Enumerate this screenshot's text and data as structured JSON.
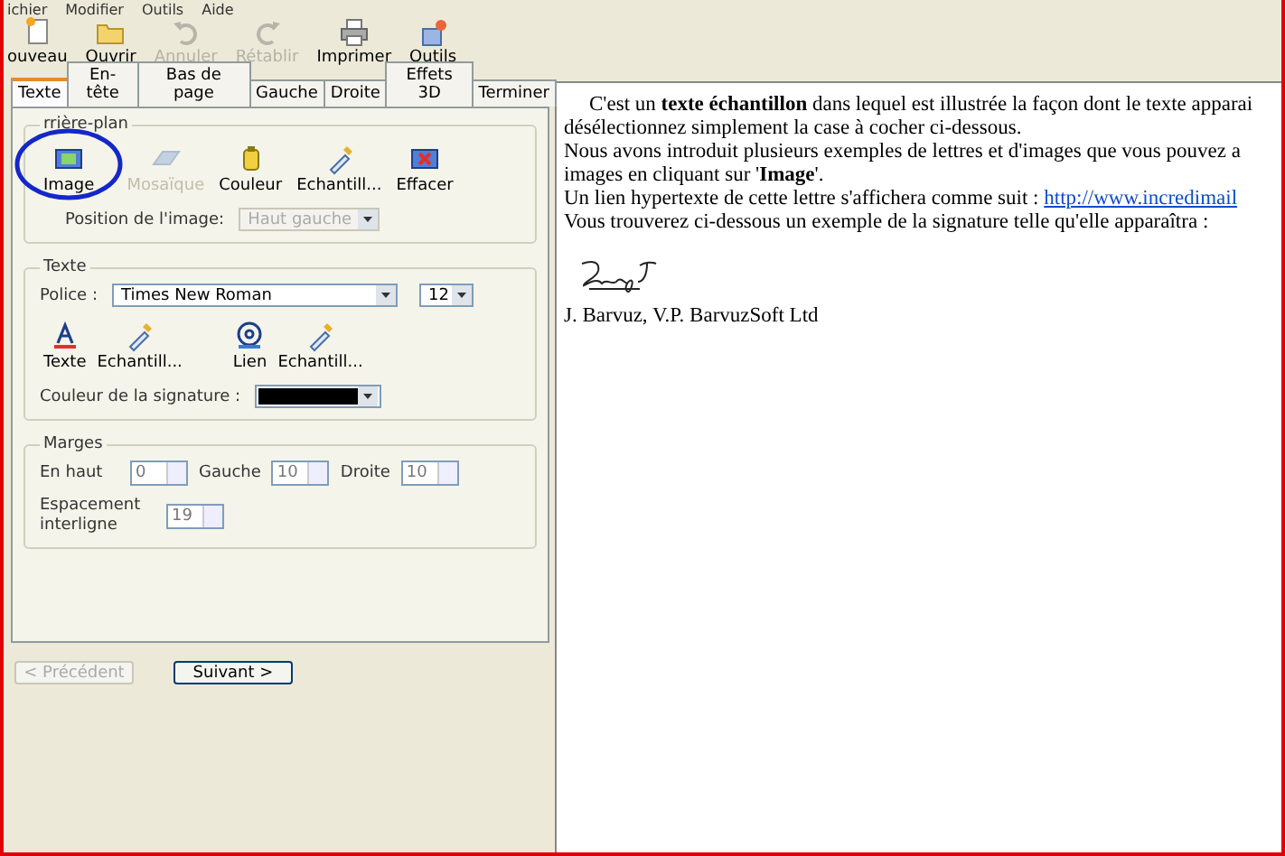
{
  "menu": [
    "ichier",
    "Modifier",
    "Outils",
    "Aide"
  ],
  "toolbar": [
    {
      "label": "ouveau",
      "disabled": false
    },
    {
      "label": "Ouvrir",
      "disabled": false
    },
    {
      "label": "Annuler",
      "disabled": true
    },
    {
      "label": "Rétablir",
      "disabled": true
    },
    {
      "label": "Imprimer",
      "disabled": false
    },
    {
      "label": "Outils",
      "disabled": false
    }
  ],
  "tabs": [
    {
      "label": "Texte",
      "selected": true
    },
    {
      "label": "En-tête",
      "selected": false
    },
    {
      "label": "Bas de page",
      "selected": false
    },
    {
      "label": "Gauche",
      "selected": false
    },
    {
      "label": "Droite",
      "selected": false
    },
    {
      "label": "Effets 3D",
      "selected": false
    },
    {
      "label": "Terminer",
      "selected": false
    }
  ],
  "background_group": {
    "title": "rrière-plan",
    "buttons": [
      {
        "label": "Image",
        "disabled": false
      },
      {
        "label": "Mosaïque",
        "disabled": true
      },
      {
        "label": "Couleur",
        "disabled": false
      },
      {
        "label": "Echantill...",
        "disabled": false
      },
      {
        "label": "Effacer",
        "disabled": false
      }
    ],
    "position_label": "Position de l'image:",
    "position_value": "Haut gauche",
    "position_disabled": true
  },
  "text_group": {
    "title": "Texte",
    "font_label": "Police :",
    "font": "Times New Roman",
    "size": "12",
    "buttons": [
      {
        "label": "Texte"
      },
      {
        "label": "Echantill..."
      },
      {
        "label": "Lien"
      },
      {
        "label": "Echantill..."
      }
    ],
    "signature_color_label": "Couleur de la signature :"
  },
  "margins_group": {
    "title": "Marges",
    "fields": [
      {
        "label": "En haut",
        "value": "0"
      },
      {
        "label": "Gauche",
        "value": "10"
      },
      {
        "label": "Droite",
        "value": "10"
      }
    ],
    "spacing_label": "Espacement interligne",
    "spacing_value": "19"
  },
  "nav": [
    {
      "label": "< Précédent",
      "disabled": true
    },
    {
      "label": "Suivant >",
      "disabled": false
    }
  ],
  "preview": {
    "lines": [
      "C'est un **texte échantillon** dans lequel est illustrée la façon dont le texte apparai",
      "désélectionnez simplement la case à cocher ci-dessous.",
      "Nous avons introduit plusieurs exemples de lettres et d'images que vous pouvez a",
      "images en cliquant sur '**Image**'."
    ],
    "link_sentence": "Un lien hypertexte de cette lettre s'affichera comme suit :",
    "link": "http://www.incredimail",
    "closing_line": "Vous trouverez ci-dessous un exemple de la signature telle qu'elle apparaîtra :",
    "signature_name": "J. Barvuz, V.P. BarvuzSoft Ltd"
  }
}
